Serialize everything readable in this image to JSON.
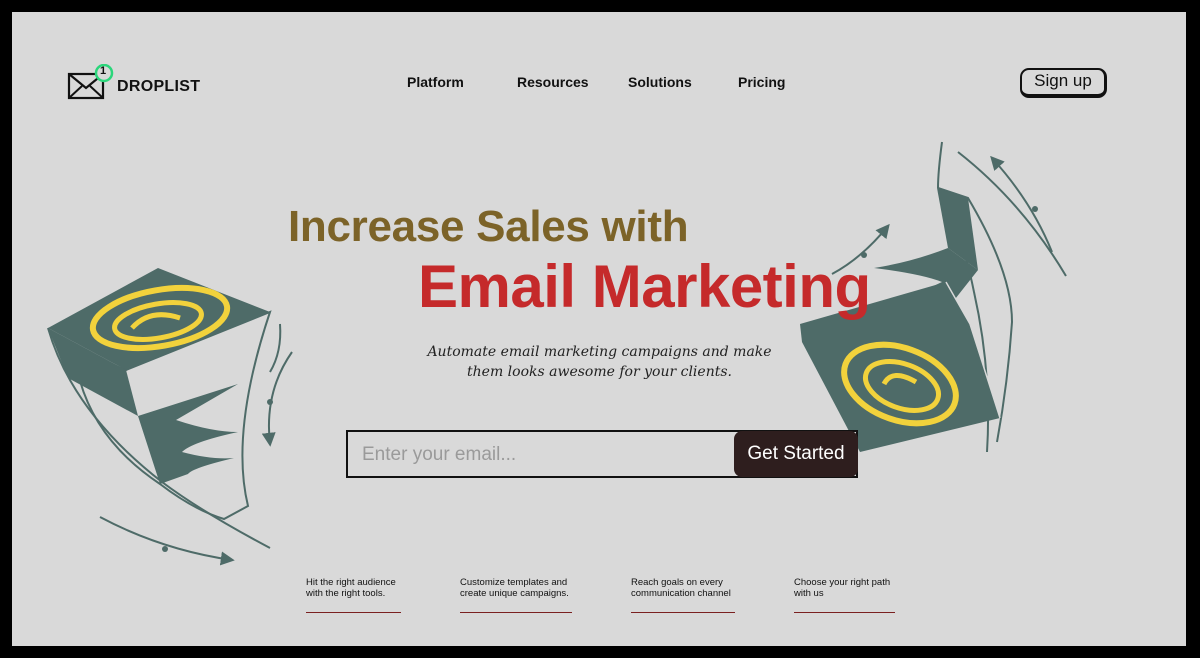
{
  "brand": {
    "name": "DROPLIST",
    "badge_count": "1"
  },
  "nav": {
    "items": [
      {
        "label": "Platform"
      },
      {
        "label": "Resources"
      },
      {
        "label": "Solutions"
      },
      {
        "label": "Pricing"
      }
    ],
    "signup_label": "Sign up"
  },
  "hero": {
    "headline_line1": "Increase Sales with",
    "headline_line2": "Email Marketing",
    "subtitle_line1": "Automate email marketing campaigns and make",
    "subtitle_line2": "them looks awesome for your clients."
  },
  "signup_form": {
    "email_placeholder": "Enter your email...",
    "email_value": "",
    "cta_label": "Get Started"
  },
  "features": [
    {
      "line1": "Hit the right audience",
      "line2": "with the right tools."
    },
    {
      "line1": "Customize templates and",
      "line2": "create unique campaigns."
    },
    {
      "line1": "Reach goals on every",
      "line2": "communication channel"
    },
    {
      "line1": "Choose your right path",
      "line2": "with us"
    }
  ],
  "colors": {
    "background": "#d9d9d9",
    "headline_brown": "#7c6328",
    "headline_red": "#c52a2b",
    "cta_dark": "#2e1e1e",
    "deco_teal": "#4e6b68",
    "deco_yellow": "#f2d23c",
    "badge_green": "#2bd67b"
  },
  "icons": [
    "envelope-icon",
    "notification-badge",
    "left-box-illustration",
    "right-box-illustration"
  ]
}
